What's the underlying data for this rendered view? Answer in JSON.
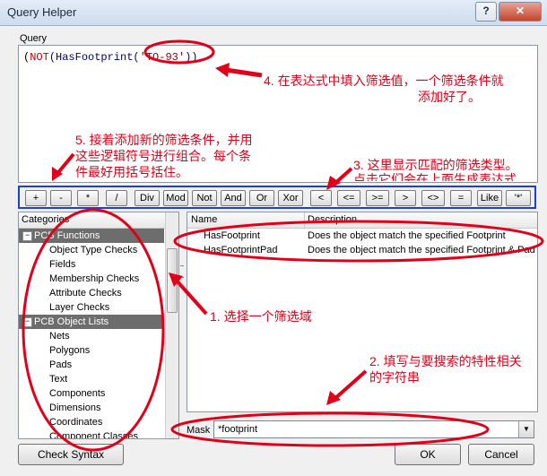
{
  "window": {
    "title": "Query Helper",
    "help_label": "?",
    "close_label": "✕"
  },
  "query": {
    "label": "Query",
    "text": {
      "open": "(",
      "not": "NOT",
      "fn_open": "(HasFootprint(",
      "arg": "'TO-93'",
      "close": "))"
    }
  },
  "operators": [
    "+",
    "-",
    "*",
    "/",
    "Div",
    "Mod",
    "Not",
    "And",
    "Or",
    "Xor",
    "<",
    "<=",
    ">=",
    ">",
    "<>",
    "=",
    "Like",
    "'*'"
  ],
  "categories": {
    "header": "Categories",
    "groups": [
      {
        "label": "PCB Functions",
        "expander": "−",
        "items": [
          "Object Type Checks",
          "Fields",
          "Membership Checks",
          "Attribute Checks",
          "Layer Checks"
        ]
      },
      {
        "label": "PCB Object Lists",
        "expander": "−",
        "items": [
          "Nets",
          "Polygons",
          "Pads",
          "Text",
          "Components",
          "Dimensions",
          "Coordinates",
          "Component Classes"
        ]
      }
    ]
  },
  "results": {
    "columns": [
      "Name",
      "Description"
    ],
    "rows": [
      {
        "name": "HasFootprint",
        "description": "Does the object match the specified Footprint"
      },
      {
        "name": "HasFootprintPad",
        "description": "Does the object match the specified Footprint & Pad"
      }
    ]
  },
  "mask": {
    "label": "Mask",
    "value": "*footprint",
    "dropdown": "▼"
  },
  "buttons": {
    "check_syntax": "Check Syntax",
    "ok": "OK",
    "cancel": "Cancel"
  },
  "annotations": {
    "n1": "1. 选择一个筛选域",
    "n2_line1": "2. 填写与要搜索的特性相关",
    "n2_line2": "的字符串",
    "n3_line1": "3. 这里显示匹配的筛选类型。",
    "n3_line2": "点击它们会在上面生成表达式",
    "n4_line1": "4. 在表达式中填入筛选值，一个筛选条件就",
    "n4_line2": "添加好了。",
    "n5_line1": "5. 接着添加新的筛选条件，并用",
    "n5_line2": "这些逻辑符号进行组合。每个条",
    "n5_line3": "件最好用括号括住。"
  },
  "colors": {
    "annotation": "#e0001a",
    "highlight_box": "#1f3fd0",
    "category_group_bg": "#6d6d6d"
  }
}
